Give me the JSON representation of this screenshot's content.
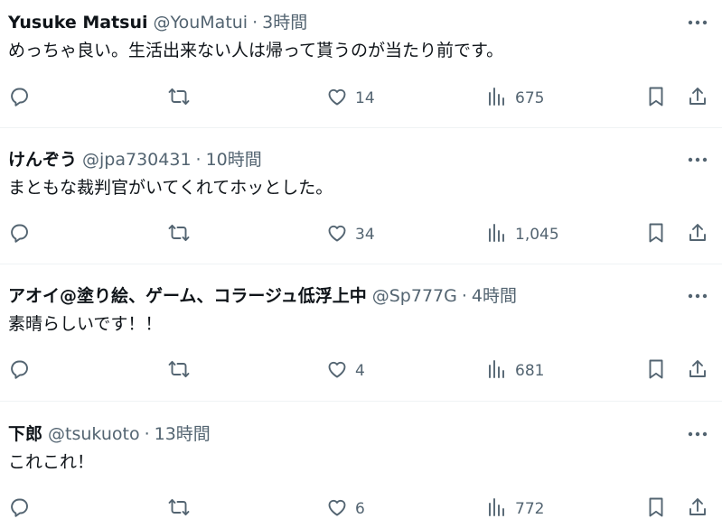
{
  "tweets": [
    {
      "name": "Yusuke Matsui",
      "handle": "@YouMatui",
      "sep": "·",
      "time": "3時間",
      "text": "めっちゃ良い。生活出来ない人は帰って貰うのが当たり前です。",
      "replies": "",
      "retweets": "",
      "likes": "14",
      "views": "675"
    },
    {
      "name": "けんぞう",
      "handle": "@jpa730431",
      "sep": "·",
      "time": "10時間",
      "text": "まともな裁判官がいてくれてホッとした。",
      "replies": "",
      "retweets": "",
      "likes": "34",
      "views": "1,045"
    },
    {
      "name": "アオイ@塗り絵、ゲーム、コラージュ低浮上中",
      "handle": "@Sp777G",
      "sep": "·",
      "time": "4時間",
      "text": "素晴らしいです！！",
      "replies": "",
      "retweets": "",
      "likes": "4",
      "views": "681"
    },
    {
      "name": "下郎",
      "handle": "@tsukuoto",
      "sep": "·",
      "time": "13時間",
      "text": "これこれ！",
      "replies": "",
      "retweets": "",
      "likes": "6",
      "views": "772"
    }
  ],
  "icons": {
    "more": "more-icon",
    "reply": "reply-icon",
    "retweet": "retweet-icon",
    "like": "heart-icon",
    "views": "views-icon",
    "bookmark": "bookmark-icon",
    "share": "share-icon"
  },
  "colors": {
    "text": "#0f1419",
    "secondary": "#536471",
    "divider": "#eff3f4",
    "background": "#ffffff"
  }
}
